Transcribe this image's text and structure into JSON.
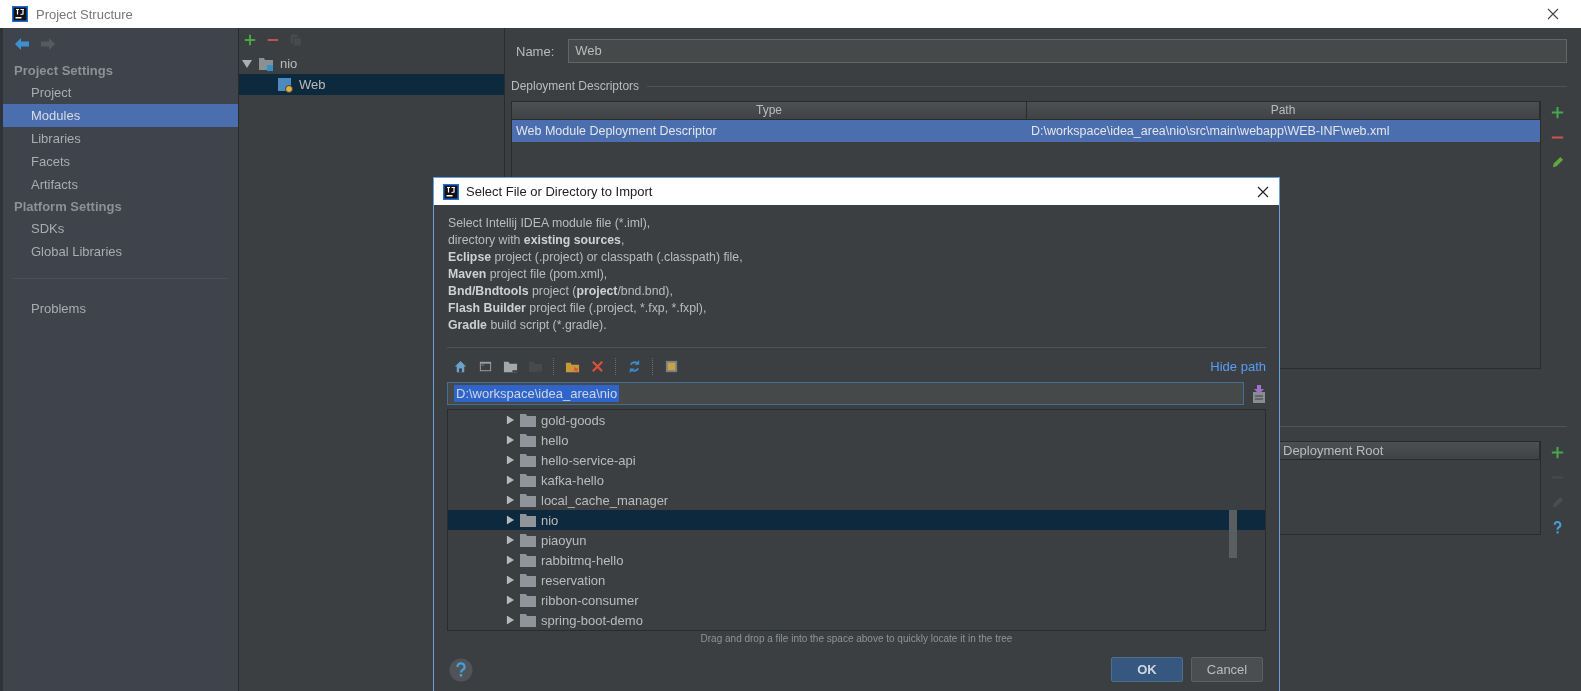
{
  "window": {
    "title": "Project Structure"
  },
  "sidebar": {
    "sections": [
      {
        "heading": "Project Settings",
        "items": [
          {
            "label": "Project",
            "selected": false
          },
          {
            "label": "Modules",
            "selected": true
          },
          {
            "label": "Libraries",
            "selected": false
          },
          {
            "label": "Facets",
            "selected": false
          },
          {
            "label": "Artifacts",
            "selected": false
          }
        ]
      },
      {
        "heading": "Platform Settings",
        "items": [
          {
            "label": "SDKs",
            "selected": false
          },
          {
            "label": "Global Libraries",
            "selected": false
          }
        ]
      }
    ],
    "footer_items": [
      {
        "label": "Problems",
        "selected": false
      }
    ]
  },
  "module_tree": {
    "toolbar": [
      {
        "kind": "add",
        "disabled": false
      },
      {
        "kind": "remove",
        "disabled": false
      },
      {
        "kind": "copy",
        "disabled": true
      }
    ],
    "nodes": [
      {
        "label": "nio",
        "kind": "folder",
        "expanded": true,
        "selected": false,
        "children": [
          {
            "label": "Web",
            "kind": "web",
            "selected": true
          }
        ]
      }
    ]
  },
  "module_editor": {
    "name_label": "Name:",
    "name_value": "Web",
    "descriptors": {
      "title": "Deployment Descriptors",
      "columns": [
        "Type",
        "Path"
      ],
      "rows": [
        {
          "cells": [
            "Web Module Deployment Descriptor",
            "D:\\workspace\\idea_area\\nio\\src\\main\\webapp\\WEB-INF\\web.xml"
          ],
          "selected": true
        }
      ],
      "toolbar": [
        {
          "kind": "add",
          "disabled": false
        },
        {
          "kind": "remove",
          "disabled": false
        },
        {
          "kind": "edit",
          "disabled": false
        }
      ]
    },
    "resources": {
      "columns": [
        "Deployment Root"
      ],
      "toolbar": [
        {
          "kind": "add",
          "disabled": false
        },
        {
          "kind": "remove",
          "disabled": true
        },
        {
          "kind": "edit",
          "disabled": true
        },
        {
          "kind": "help",
          "disabled": false
        }
      ]
    }
  },
  "dialog": {
    "title": "Select File or Directory to Import",
    "description": [
      "Select Intellij IDEA module file (*.iml),",
      "directory with **existing sources**,",
      "**Eclipse** project (.project) or classpath (.classpath) file,",
      "**Maven** project file (pom.xml),",
      "**Bnd/Bndtools** project (**project**/bnd.bnd),",
      "**Flash Builder** project file (.project, *.fxp, *.fxpl),",
      "**Gradle** build script (*.gradle)."
    ],
    "toolbar_groups": [
      {
        "tools": [
          {
            "kind": "home",
            "disabled": false
          },
          {
            "kind": "desktop",
            "disabled": false
          },
          {
            "kind": "folder",
            "disabled": false
          },
          {
            "kind": "folder",
            "disabled": true
          }
        ]
      },
      {
        "tools": [
          {
            "kind": "new-folder",
            "disabled": false
          },
          {
            "kind": "delete",
            "disabled": false
          }
        ]
      },
      {
        "tools": [
          {
            "kind": "refresh",
            "disabled": false
          }
        ]
      },
      {
        "tools": [
          {
            "kind": "hidden",
            "disabled": false
          }
        ]
      }
    ],
    "hide_path": "Hide path",
    "path": "D:\\workspace\\idea_area\\nio",
    "tree": [
      {
        "label": "gold-goods",
        "expanded": false,
        "selected": false
      },
      {
        "label": "hello",
        "expanded": false,
        "selected": false
      },
      {
        "label": "hello-service-api",
        "expanded": false,
        "selected": false
      },
      {
        "label": "kafka-hello",
        "expanded": false,
        "selected": false
      },
      {
        "label": "local_cache_manager",
        "expanded": false,
        "selected": false
      },
      {
        "label": "nio",
        "expanded": false,
        "selected": true
      },
      {
        "label": "piaoyun",
        "expanded": false,
        "selected": false
      },
      {
        "label": "rabbitmq-hello",
        "expanded": false,
        "selected": false
      },
      {
        "label": "reservation",
        "expanded": false,
        "selected": false
      },
      {
        "label": "ribbon-consumer",
        "expanded": false,
        "selected": false
      },
      {
        "label": "spring-boot-demo",
        "expanded": false,
        "selected": false
      }
    ],
    "hint": "Drag and drop a file into the space above to quickly locate it in the tree",
    "buttons": [
      {
        "label": "OK",
        "kind": "default"
      },
      {
        "label": "Cancel",
        "kind": "normal"
      }
    ]
  }
}
